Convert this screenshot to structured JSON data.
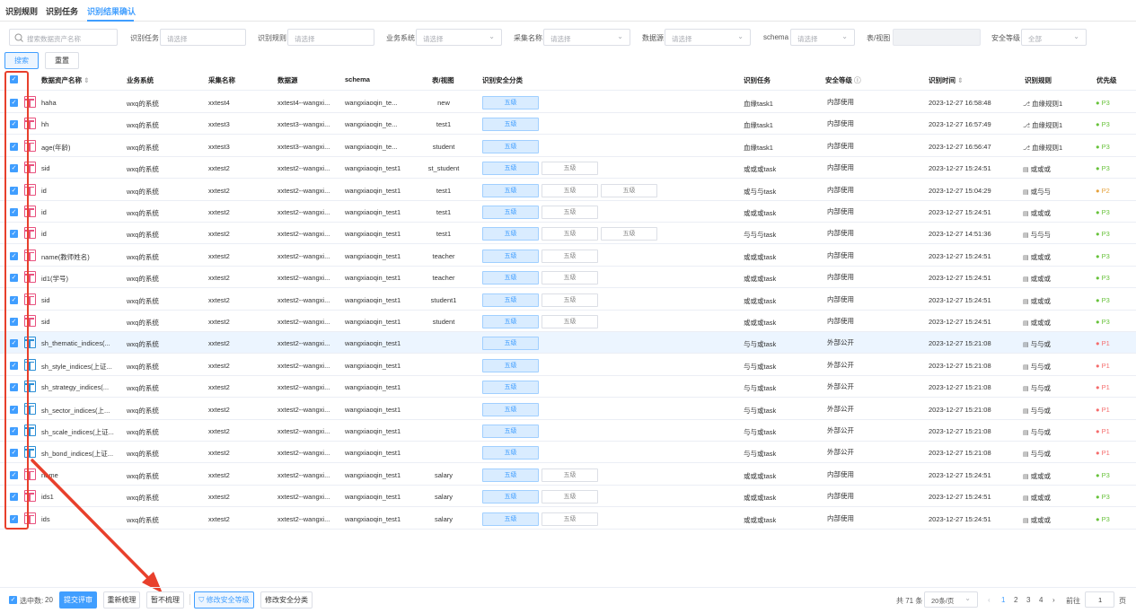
{
  "tabs": [
    {
      "label": "识别规则"
    },
    {
      "label": "识别任务"
    },
    {
      "label": "识别结果确认"
    }
  ],
  "filters": {
    "search_placeholder": "搜索数据资产名称",
    "task_label": "识别任务",
    "task_placeholder": "请选择",
    "rule_label": "识别规则",
    "rule_placeholder": "请选择",
    "biz_label": "业务系统",
    "biz_placeholder": "请选择",
    "collect_label": "采集名称",
    "collect_placeholder": "请选择",
    "ds_label": "数据源",
    "ds_placeholder": "请选择",
    "schema_label": "schema",
    "schema_placeholder": "请选择",
    "table_label": "表/视图",
    "level_label": "安全等级",
    "level_value": "全部"
  },
  "actions": {
    "search": "搜索",
    "reset": "重置"
  },
  "columns": {
    "name": "数据资产名称",
    "biz": "业务系统",
    "collect": "采集名称",
    "ds": "数据源",
    "schema": "schema",
    "table": "表/视图",
    "cls": "识别安全分类",
    "task": "识别任务",
    "level": "安全等级",
    "time": "识别时间",
    "rule": "识别规则",
    "prio": "优先级"
  },
  "rows": [
    {
      "name": "haha",
      "biz": "wxq的系统",
      "collect": "xxtest4",
      "ds": "xxtest4--wangxi...",
      "schema": "wangxiaoqin_te...",
      "table": "new",
      "tags": [
        "五级"
      ],
      "task": "血缘task1",
      "level": "内部使用",
      "time": "2023-12-27 16:58:48",
      "rule": "血缘规则1",
      "rule_icon": "lineage",
      "prio": "P3",
      "icon": "table"
    },
    {
      "name": "hh",
      "biz": "wxq的系统",
      "collect": "xxtest3",
      "ds": "xxtest3--wangxi...",
      "schema": "wangxiaoqin_te...",
      "table": "test1",
      "tags": [
        "五级"
      ],
      "task": "血缘task1",
      "level": "内部使用",
      "time": "2023-12-27 16:57:49",
      "rule": "血缘规则1",
      "rule_icon": "lineage",
      "prio": "P3",
      "icon": "table"
    },
    {
      "name": "age(年龄)",
      "biz": "wxq的系统",
      "collect": "xxtest3",
      "ds": "xxtest3--wangxi...",
      "schema": "wangxiaoqin_te...",
      "table": "student",
      "tags": [
        "五级"
      ],
      "task": "血缘task1",
      "level": "内部使用",
      "time": "2023-12-27 16:56:47",
      "rule": "血缘规则1",
      "rule_icon": "lineage",
      "prio": "P3",
      "icon": "table"
    },
    {
      "name": "sid",
      "biz": "wxq的系统",
      "collect": "xxtest2",
      "ds": "xxtest2--wangxi...",
      "schema": "wangxiaoqin_test1",
      "table": "st_student",
      "tags": [
        "五级",
        "五级"
      ],
      "task": "或或或task",
      "level": "内部使用",
      "time": "2023-12-27 15:24:51",
      "rule": "或或或",
      "rule_icon": "doc",
      "prio": "P3",
      "icon": "table"
    },
    {
      "name": "id",
      "biz": "wxq的系统",
      "collect": "xxtest2",
      "ds": "xxtest2--wangxi...",
      "schema": "wangxiaoqin_test1",
      "table": "test1",
      "tags": [
        "五级",
        "五级",
        "五级"
      ],
      "task": "或与与task",
      "level": "内部使用",
      "time": "2023-12-27 15:04:29",
      "rule": "或与与",
      "rule_icon": "doc",
      "prio": "P2",
      "icon": "table"
    },
    {
      "name": "id",
      "biz": "wxq的系统",
      "collect": "xxtest2",
      "ds": "xxtest2--wangxi...",
      "schema": "wangxiaoqin_test1",
      "table": "test1",
      "tags": [
        "五级",
        "五级"
      ],
      "task": "或或或task",
      "level": "内部使用",
      "time": "2023-12-27 15:24:51",
      "rule": "或或或",
      "rule_icon": "doc",
      "prio": "P3",
      "icon": "table"
    },
    {
      "name": "id",
      "biz": "wxq的系统",
      "collect": "xxtest2",
      "ds": "xxtest2--wangxi...",
      "schema": "wangxiaoqin_test1",
      "table": "test1",
      "tags": [
        "五级",
        "五级",
        "五级"
      ],
      "task": "与与与task",
      "level": "内部使用",
      "time": "2023-12-27 14:51:36",
      "rule": "与与与",
      "rule_icon": "doc",
      "prio": "P3",
      "icon": "table"
    },
    {
      "name": "name(教师姓名)",
      "biz": "wxq的系统",
      "collect": "xxtest2",
      "ds": "xxtest2--wangxi...",
      "schema": "wangxiaoqin_test1",
      "table": "teacher",
      "tags": [
        "五级",
        "五级"
      ],
      "task": "或或或task",
      "level": "内部使用",
      "time": "2023-12-27 15:24:51",
      "rule": "或或或",
      "rule_icon": "doc",
      "prio": "P3",
      "icon": "table"
    },
    {
      "name": "id1(学号)",
      "biz": "wxq的系统",
      "collect": "xxtest2",
      "ds": "xxtest2--wangxi...",
      "schema": "wangxiaoqin_test1",
      "table": "teacher",
      "tags": [
        "五级",
        "五级"
      ],
      "task": "或或或task",
      "level": "内部使用",
      "time": "2023-12-27 15:24:51",
      "rule": "或或或",
      "rule_icon": "doc",
      "prio": "P3",
      "icon": "table"
    },
    {
      "name": "sid",
      "biz": "wxq的系统",
      "collect": "xxtest2",
      "ds": "xxtest2--wangxi...",
      "schema": "wangxiaoqin_test1",
      "table": "student1",
      "tags": [
        "五级",
        "五级"
      ],
      "task": "或或或task",
      "level": "内部使用",
      "time": "2023-12-27 15:24:51",
      "rule": "或或或",
      "rule_icon": "doc",
      "prio": "P3",
      "icon": "table"
    },
    {
      "name": "sid",
      "biz": "wxq的系统",
      "collect": "xxtest2",
      "ds": "xxtest2--wangxi...",
      "schema": "wangxiaoqin_test1",
      "table": "student",
      "tags": [
        "五级",
        "五级"
      ],
      "task": "或或或task",
      "level": "内部使用",
      "time": "2023-12-27 15:24:51",
      "rule": "或或或",
      "rule_icon": "doc",
      "prio": "P3",
      "icon": "table"
    },
    {
      "name": "sh_thematic_indices(...",
      "biz": "wxq的系统",
      "collect": "xxtest2",
      "ds": "xxtest2--wangxi...",
      "schema": "wangxiaoqin_test1",
      "table": "",
      "tags": [
        "五级"
      ],
      "task": "与与或task",
      "level": "外部公开",
      "time": "2023-12-27 15:21:08",
      "rule": "与与或",
      "rule_icon": "doc",
      "prio": "P1",
      "icon": "grid",
      "hl": true
    },
    {
      "name": "sh_style_indices(上证...",
      "biz": "wxq的系统",
      "collect": "xxtest2",
      "ds": "xxtest2--wangxi...",
      "schema": "wangxiaoqin_test1",
      "table": "",
      "tags": [
        "五级"
      ],
      "task": "与与或task",
      "level": "外部公开",
      "time": "2023-12-27 15:21:08",
      "rule": "与与或",
      "rule_icon": "doc",
      "prio": "P1",
      "icon": "grid"
    },
    {
      "name": "sh_strategy_indices(...",
      "biz": "wxq的系统",
      "collect": "xxtest2",
      "ds": "xxtest2--wangxi...",
      "schema": "wangxiaoqin_test1",
      "table": "",
      "tags": [
        "五级"
      ],
      "task": "与与或task",
      "level": "外部公开",
      "time": "2023-12-27 15:21:08",
      "rule": "与与或",
      "rule_icon": "doc",
      "prio": "P1",
      "icon": "grid"
    },
    {
      "name": "sh_sector_indices(上...",
      "biz": "wxq的系统",
      "collect": "xxtest2",
      "ds": "xxtest2--wangxi...",
      "schema": "wangxiaoqin_test1",
      "table": "",
      "tags": [
        "五级"
      ],
      "task": "与与或task",
      "level": "外部公开",
      "time": "2023-12-27 15:21:08",
      "rule": "与与或",
      "rule_icon": "doc",
      "prio": "P1",
      "icon": "grid"
    },
    {
      "name": "sh_scale_indices(上证...",
      "biz": "wxq的系统",
      "collect": "xxtest2",
      "ds": "xxtest2--wangxi...",
      "schema": "wangxiaoqin_test1",
      "table": "",
      "tags": [
        "五级"
      ],
      "task": "与与或task",
      "level": "外部公开",
      "time": "2023-12-27 15:21:08",
      "rule": "与与或",
      "rule_icon": "doc",
      "prio": "P1",
      "icon": "grid"
    },
    {
      "name": "sh_bond_indices(上证...",
      "biz": "wxq的系统",
      "collect": "xxtest2",
      "ds": "xxtest2--wangxi...",
      "schema": "wangxiaoqin_test1",
      "table": "",
      "tags": [
        "五级"
      ],
      "task": "与与或task",
      "level": "外部公开",
      "time": "2023-12-27 15:21:08",
      "rule": "与与或",
      "rule_icon": "doc",
      "prio": "P1",
      "icon": "grid"
    },
    {
      "name": "name",
      "biz": "wxq的系统",
      "collect": "xxtest2",
      "ds": "xxtest2--wangxi...",
      "schema": "wangxiaoqin_test1",
      "table": "salary",
      "tags": [
        "五级",
        "五级"
      ],
      "task": "或或或task",
      "level": "内部使用",
      "time": "2023-12-27 15:24:51",
      "rule": "或或或",
      "rule_icon": "doc",
      "prio": "P3",
      "icon": "table"
    },
    {
      "name": "ids1",
      "biz": "wxq的系统",
      "collect": "xxtest2",
      "ds": "xxtest2--wangxi...",
      "schema": "wangxiaoqin_test1",
      "table": "salary",
      "tags": [
        "五级",
        "五级"
      ],
      "task": "或或或task",
      "level": "内部使用",
      "time": "2023-12-27 15:24:51",
      "rule": "或或或",
      "rule_icon": "doc",
      "prio": "P3",
      "icon": "table"
    },
    {
      "name": "ids",
      "biz": "wxq的系统",
      "collect": "xxtest2",
      "ds": "xxtest2--wangxi...",
      "schema": "wangxiaoqin_test1",
      "table": "salary",
      "tags": [
        "五级",
        "五级"
      ],
      "task": "或或或task",
      "level": "内部使用",
      "time": "2023-12-27 15:24:51",
      "rule": "或或或",
      "rule_icon": "doc",
      "prio": "P3",
      "icon": "table"
    }
  ],
  "footer": {
    "selected_label": "选中数:",
    "selected_count": "20",
    "submit": "提交评审",
    "recomb": "重新梳理",
    "skip": "暂不梳理",
    "modify_level": "修改安全等级",
    "modify_cls": "修改安全分类",
    "total": "共 71 条",
    "page_size": "20条/页",
    "pages": [
      "1",
      "2",
      "3",
      "4"
    ],
    "goto": "前往",
    "page_input": "1",
    "page_unit": "页"
  },
  "colors": {
    "accent": "#409eff",
    "p1": "#f56c6c",
    "p2": "#e6a23c",
    "p3": "#67c23a",
    "annotation": "#e8402c"
  }
}
